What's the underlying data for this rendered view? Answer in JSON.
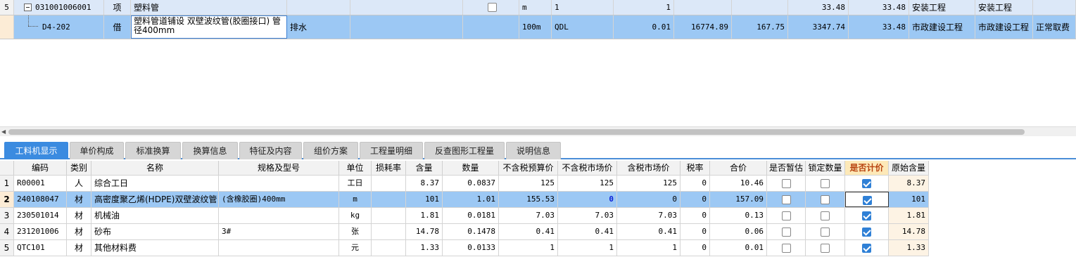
{
  "upper_grid": {
    "rows": [
      {
        "num": "5",
        "code": "031001006001",
        "type": "项",
        "name": "塑料管",
        "feature": "",
        "unit": "m",
        "qty_expr": "1",
        "qty": "1",
        "price1": "",
        "price2": "",
        "price3": "33.48",
        "price4": "33.48",
        "major1": "安装工程",
        "major2": "安装工程",
        "fee": ""
      },
      {
        "num": "",
        "code": "D4-202",
        "type": "借",
        "name": "塑料管道铺设 双壁波纹管(胶圈接口) 管径400mm",
        "feature": "排水",
        "unit": "100m",
        "qty_expr": "QDL",
        "qty": "0.01",
        "price1": "16774.89",
        "price2": "167.75",
        "price3": "3347.74",
        "price4": "33.48",
        "major1": "市政建设工程",
        "major2": "市政建设工程",
        "fee": "正常取费"
      }
    ]
  },
  "tabs": [
    {
      "label": "工料机显示",
      "active": true
    },
    {
      "label": "单价构成",
      "active": false
    },
    {
      "label": "标准换算",
      "active": false
    },
    {
      "label": "换算信息",
      "active": false
    },
    {
      "label": "特征及内容",
      "active": false
    },
    {
      "label": "组价方案",
      "active": false
    },
    {
      "label": "工程量明细",
      "active": false
    },
    {
      "label": "反查图形工程量",
      "active": false
    },
    {
      "label": "说明信息",
      "active": false
    }
  ],
  "lower_grid": {
    "headers": {
      "code": "编码",
      "cat": "类别",
      "name": "名称",
      "spec": "规格及型号",
      "unit": "单位",
      "loss": "损耗率",
      "content": "含量",
      "qty": "数量",
      "budget_ex": "不含税预算价",
      "market_ex": "不含税市场价",
      "market_in": "含税市场价",
      "tax": "税率",
      "total": "合价",
      "est": "是否暂估",
      "lock": "锁定数量",
      "priced": "是否计价",
      "orig": "原始含量"
    },
    "rows": [
      {
        "num": "1",
        "code": "R00001",
        "cat": "人",
        "name": "综合工日",
        "spec": "",
        "unit": "工日",
        "loss": "",
        "content": "8.37",
        "qty": "0.0837",
        "budget_ex": "125",
        "market_ex": "125",
        "market_in": "125",
        "tax": "0",
        "total": "10.46",
        "est": false,
        "lock": false,
        "priced": true,
        "orig": "8.37"
      },
      {
        "num": "2",
        "code": "240108047",
        "cat": "材",
        "name": "高密度聚乙烯(HDPE)双壁波纹管",
        "spec": "(含橡胶圈)400mm",
        "unit": "m",
        "loss": "",
        "content": "101",
        "qty": "1.01",
        "budget_ex": "155.53",
        "market_ex": "0",
        "market_in": "0",
        "tax": "0",
        "total": "157.09",
        "est": false,
        "lock": false,
        "priced": true,
        "orig": "101"
      },
      {
        "num": "3",
        "code": "230501014",
        "cat": "材",
        "name": "机械油",
        "spec": "",
        "unit": "kg",
        "loss": "",
        "content": "1.81",
        "qty": "0.0181",
        "budget_ex": "7.03",
        "market_ex": "7.03",
        "market_in": "7.03",
        "tax": "0",
        "total": "0.13",
        "est": false,
        "lock": false,
        "priced": true,
        "orig": "1.81"
      },
      {
        "num": "4",
        "code": "231201006",
        "cat": "材",
        "name": "砂布",
        "spec": "3#",
        "unit": "张",
        "loss": "",
        "content": "14.78",
        "qty": "0.1478",
        "budget_ex": "0.41",
        "market_ex": "0.41",
        "market_in": "0.41",
        "tax": "0",
        "total": "0.06",
        "est": false,
        "lock": false,
        "priced": true,
        "orig": "14.78"
      },
      {
        "num": "5",
        "code": "QTC101",
        "cat": "材",
        "name": "其他材料费",
        "spec": "",
        "unit": "元",
        "loss": "",
        "content": "1.33",
        "qty": "0.0133",
        "budget_ex": "1",
        "market_ex": "1",
        "market_in": "1",
        "tax": "0",
        "total": "0.01",
        "est": false,
        "lock": false,
        "priced": true,
        "orig": "1.33"
      }
    ]
  },
  "colors": {
    "selected_row": "#9cc8f4",
    "tab_active": "#3b8be0",
    "header_highlight": "#fde9b8"
  }
}
